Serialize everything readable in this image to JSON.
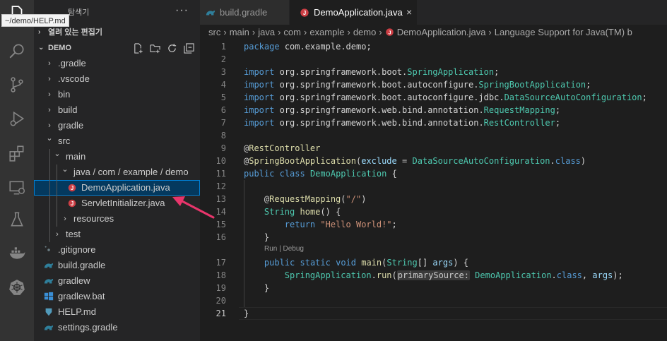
{
  "tooltip": "~/demo/HELP.md",
  "activity_icons": [
    "files-icon",
    "search-icon",
    "source-control-icon",
    "run-debug-icon",
    "extensions-icon",
    "remote-explorer-icon",
    "testing-icon",
    "docker-icon",
    "kubernetes-icon"
  ],
  "sidebar": {
    "title": "탐색기",
    "more": "···",
    "open_editors": "열려 있는 편집기",
    "project": "DEMO",
    "tree": [
      {
        "label": ".gradle",
        "kind": "folder",
        "expanded": false,
        "depth": 0
      },
      {
        "label": ".vscode",
        "kind": "folder",
        "expanded": false,
        "depth": 0
      },
      {
        "label": "bin",
        "kind": "folder",
        "expanded": false,
        "depth": 0
      },
      {
        "label": "build",
        "kind": "folder",
        "expanded": false,
        "depth": 0
      },
      {
        "label": "gradle",
        "kind": "folder",
        "expanded": false,
        "depth": 0
      },
      {
        "label": "src",
        "kind": "folder",
        "expanded": true,
        "depth": 0
      },
      {
        "label": "main",
        "kind": "folder",
        "expanded": true,
        "depth": 1
      },
      {
        "label": "java / com / example / demo",
        "kind": "folder",
        "expanded": true,
        "depth": 2
      },
      {
        "label": "DemoApplication.java",
        "kind": "java",
        "depth": 3,
        "selected": true
      },
      {
        "label": "ServletInitializer.java",
        "kind": "java",
        "depth": 3
      },
      {
        "label": "resources",
        "kind": "folder",
        "expanded": false,
        "depth": 2
      },
      {
        "label": "test",
        "kind": "folder",
        "expanded": false,
        "depth": 1
      },
      {
        "label": ".gitignore",
        "kind": "gitignore",
        "depth": 0
      },
      {
        "label": "build.gradle",
        "kind": "gradle",
        "depth": 0
      },
      {
        "label": "gradlew",
        "kind": "gradle",
        "depth": 0
      },
      {
        "label": "gradlew.bat",
        "kind": "windows",
        "depth": 0
      },
      {
        "label": "HELP.md",
        "kind": "markdown",
        "depth": 0
      },
      {
        "label": "settings.gradle",
        "kind": "gradle",
        "depth": 0
      }
    ]
  },
  "tabs": [
    {
      "label": "build.gradle",
      "active": false,
      "icon": "gradle-icon"
    },
    {
      "label": "DemoApplication.java",
      "active": true,
      "icon": "java-icon",
      "close": "×"
    }
  ],
  "breadcrumb": [
    "src",
    "main",
    "java",
    "com",
    "example",
    "demo",
    "DemoApplication.java",
    "Language Support for Java(TM) b"
  ],
  "breadcrumb_sep": "›",
  "code": {
    "current_line": 21,
    "codelens": "Run | Debug",
    "lines": [
      {
        "n": "1",
        "text": "package com.example.demo;"
      },
      {
        "n": "2",
        "text": ""
      },
      {
        "n": "3",
        "text": "import org.springframework.boot.SpringApplication;"
      },
      {
        "n": "4",
        "text": "import org.springframework.boot.autoconfigure.SpringBootApplication;"
      },
      {
        "n": "5",
        "text": "import org.springframework.boot.autoconfigure.jdbc.DataSourceAutoConfiguration;"
      },
      {
        "n": "6",
        "text": "import org.springframework.web.bind.annotation.RequestMapping;"
      },
      {
        "n": "7",
        "text": "import org.springframework.web.bind.annotation.RestController;"
      },
      {
        "n": "8",
        "text": ""
      },
      {
        "n": "9",
        "text": "@RestController"
      },
      {
        "n": "10",
        "text": "@SpringBootApplication(exclude = DataSourceAutoConfiguration.class)"
      },
      {
        "n": "11",
        "text": "public class DemoApplication {"
      },
      {
        "n": "12",
        "text": ""
      },
      {
        "n": "13",
        "text": "    @RequestMapping(\"/\")"
      },
      {
        "n": "14",
        "text": "    String home() {"
      },
      {
        "n": "15",
        "text": "        return \"Hello World!\";"
      },
      {
        "n": "16",
        "text": "    }"
      },
      {
        "n": "17",
        "text": "    public static void main(String[] args) {"
      },
      {
        "n": "18",
        "text": "        SpringApplication.run(primarySource: DemoApplication.class, args);"
      },
      {
        "n": "19",
        "text": "    }"
      },
      {
        "n": "20",
        "text": ""
      },
      {
        "n": "21",
        "text": "}"
      }
    ]
  },
  "colors": {
    "accent": "#007fd4",
    "arrow": "#e8356b",
    "java_icon": "#cc3e44"
  }
}
